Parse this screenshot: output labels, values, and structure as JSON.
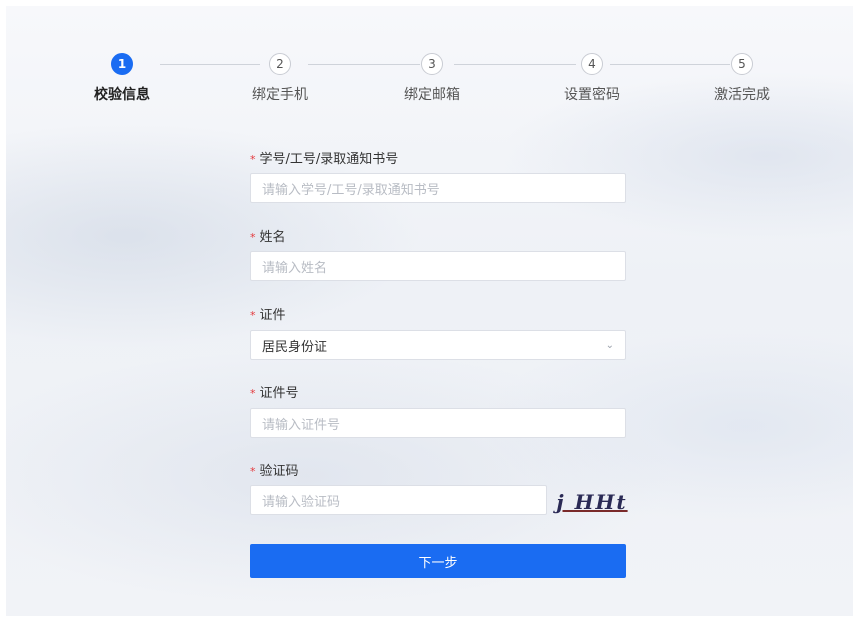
{
  "steps": [
    {
      "number": "1",
      "label": "校验信息",
      "active": true
    },
    {
      "number": "2",
      "label": "绑定手机",
      "active": false
    },
    {
      "number": "3",
      "label": "绑定邮箱",
      "active": false
    },
    {
      "number": "4",
      "label": "设置密码",
      "active": false
    },
    {
      "number": "5",
      "label": "激活完成",
      "active": false
    }
  ],
  "form": {
    "required_mark": "*",
    "id_number": {
      "label": "学号/工号/录取通知书号",
      "placeholder": "请输入学号/工号/录取通知书号"
    },
    "name": {
      "label": "姓名",
      "placeholder": "请输入姓名"
    },
    "doc_type": {
      "label": "证件",
      "value": "居民身份证"
    },
    "doc_number": {
      "label": "证件号",
      "placeholder": "请输入证件号"
    },
    "captcha": {
      "label": "验证码",
      "placeholder": "请输入验证码",
      "image_text": "j HHt"
    },
    "submit_label": "下一步"
  },
  "colors": {
    "accent": "#1a6cf2",
    "required": "#e4393c"
  }
}
